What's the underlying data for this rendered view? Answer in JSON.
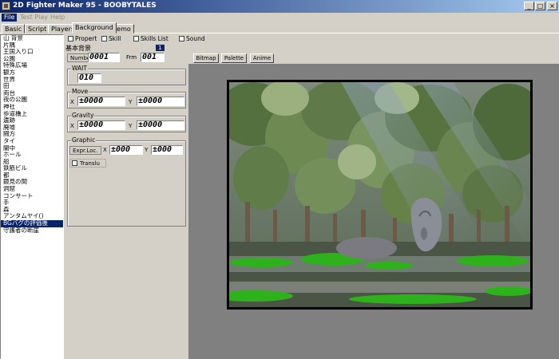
{
  "window": {
    "title": "2D Fighter Maker 95 - BOOBYTALES",
    "buttons": [
      "_",
      "□",
      "×"
    ]
  },
  "menu": [
    "File",
    "Test Play",
    "Help"
  ],
  "tabs": [
    "Basic",
    "Script",
    "Players",
    "Background",
    "Demo"
  ],
  "active_tab": "Background",
  "background_list": [
    "山 背景",
    "片隅",
    "王国入り口",
    "公園",
    "特殊広場",
    "観方",
    "世界",
    "田",
    "両台",
    "夜の公園",
    "神社",
    "歩道橋上",
    "遺跡",
    "廃墟",
    "闘方",
    "タイ",
    "闇中",
    "ホール",
    "船",
    "鉄筋ビル",
    "都",
    "鏡見の間",
    "洞窟",
    "コンサート",
    "手",
    "森",
    "アンタムヤイ()",
    "BGバグの評価後",
    "守護者の断崖"
  ],
  "selected_background": "BGバグの評価後",
  "subtabs": [
    "Propert",
    "Skill",
    "Skills List",
    "Sound"
  ],
  "editor": {
    "name": "基本背景",
    "id": "1",
    "number_label": "Number",
    "number_value": "0001",
    "frm_label": "Frm",
    "frm_value": "001",
    "buttons": [
      "Bitmap",
      "Palette",
      "Anime"
    ],
    "wait": {
      "label": "WAIT",
      "value": "010"
    },
    "move": {
      "label": "Move",
      "x_label": "X",
      "x_value": "±0000",
      "y_label": "Y",
      "y_value": "±0000"
    },
    "gravity": {
      "label": "Gravity",
      "x_label": "X",
      "x_value": "±0000",
      "y_label": "Y",
      "y_value": "±0000"
    },
    "graphic": {
      "label": "Graphic",
      "expr_label": "Expr.Loc.",
      "x_label": "X",
      "x_value": "±000",
      "y_label": "Y",
      "y_value": "±000",
      "translu_label": "Translu"
    }
  },
  "colors": {
    "titlebar_start": "#0a246a",
    "titlebar_end": "#a6caf0",
    "selection": "#0a246a",
    "canvas_bg": "#808080",
    "chrome": "#d4d0c8"
  }
}
